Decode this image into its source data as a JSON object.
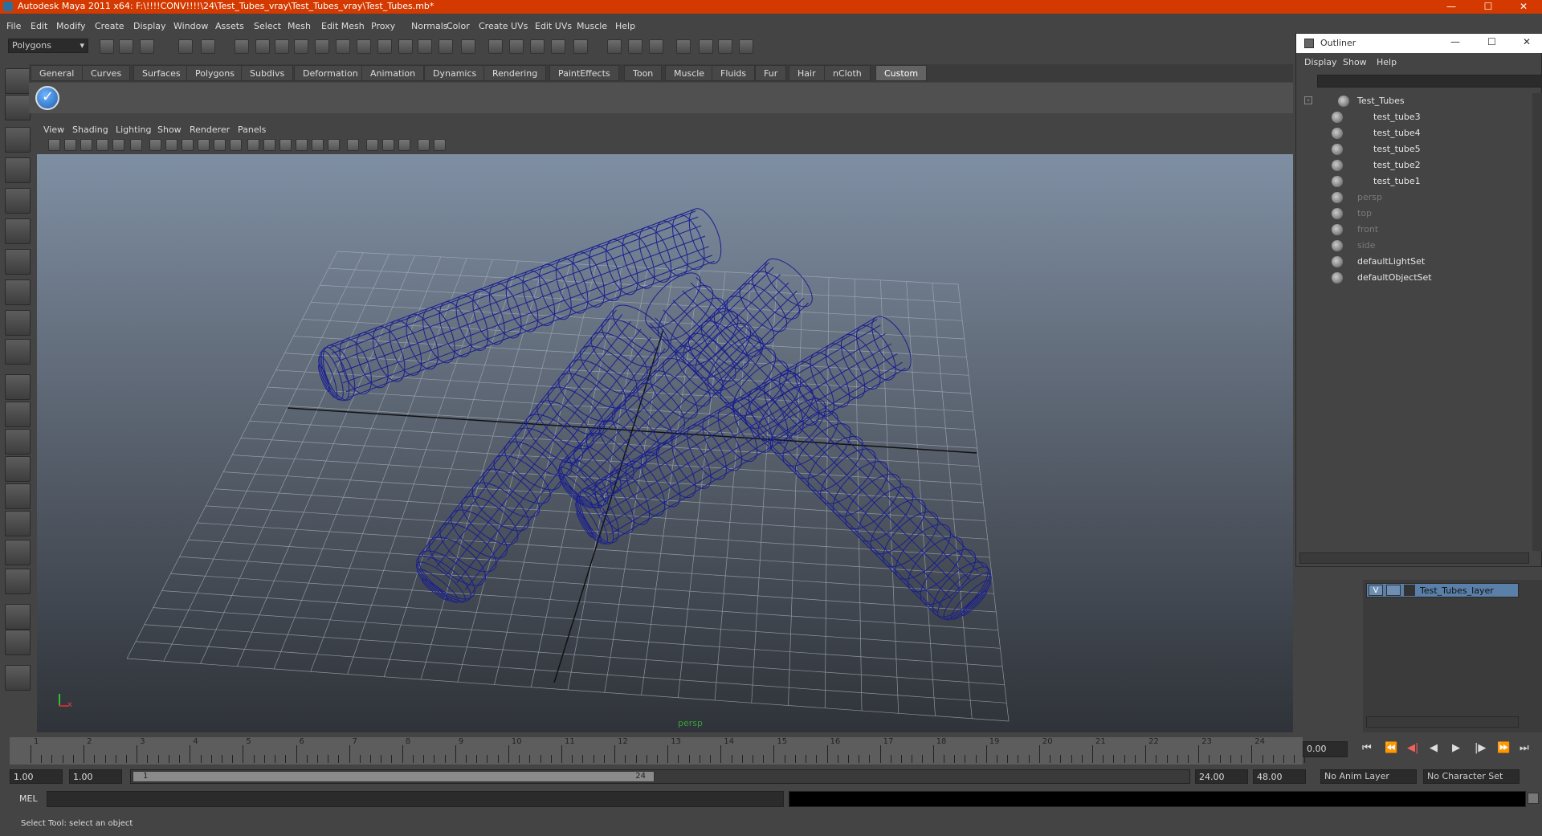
{
  "window_title": "Autodesk Maya 2011 x64: F:\\!!!!CONV!!!!\\24\\Test_Tubes_vray\\Test_Tubes_vray\\Test_Tubes.mb*",
  "menus": [
    "File",
    "Edit",
    "Modify",
    "Create",
    "Display",
    "Window",
    "Assets",
    "Select",
    "Mesh",
    "Edit Mesh",
    "Proxy",
    "Normals",
    "Color",
    "Create UVs",
    "Edit UVs",
    "Muscle",
    "Help"
  ],
  "mode_selector": "Polygons",
  "shelf_tabs": [
    "General",
    "Curves",
    "Surfaces",
    "Polygons",
    "Subdivs",
    "Deformation",
    "Animation",
    "Dynamics",
    "Rendering",
    "PaintEffects",
    "Toon",
    "Muscle",
    "Fluids",
    "Fur",
    "Hair",
    "nCloth",
    "Custom"
  ],
  "active_shelf_tab": "Custom",
  "viewport_menus": [
    "View",
    "Shading",
    "Lighting",
    "Show",
    "Renderer",
    "Panels"
  ],
  "camera_label": "persp",
  "axis_x": "x",
  "timeline": {
    "ticks": [
      "1",
      "2",
      "3",
      "4",
      "5",
      "6",
      "7",
      "8",
      "9",
      "10",
      "11",
      "12",
      "13",
      "14",
      "15",
      "16",
      "17",
      "18",
      "19",
      "20",
      "21",
      "22",
      "23",
      "24"
    ],
    "current_time": "0.00"
  },
  "range": {
    "start_time": "1.00",
    "start_range": "1.00",
    "range_slider_start": "1",
    "range_slider_end": "24",
    "end_range": "24.00",
    "end_time": "48.00",
    "anim_layer": "No Anim Layer",
    "character_set": "No Character Set"
  },
  "mel_label": "MEL",
  "help_line": "Select Tool: select an object",
  "outliner": {
    "title": "Outliner",
    "menus": [
      "Display",
      "Show",
      "Help"
    ],
    "items": [
      {
        "label": "Test_Tubes",
        "level": 0,
        "dim": false
      },
      {
        "label": "test_tube3",
        "level": 1,
        "dim": false
      },
      {
        "label": "test_tube4",
        "level": 1,
        "dim": false
      },
      {
        "label": "test_tube5",
        "level": 1,
        "dim": false
      },
      {
        "label": "test_tube2",
        "level": 1,
        "dim": false
      },
      {
        "label": "test_tube1",
        "level": 1,
        "dim": false
      },
      {
        "label": "persp",
        "level": 0,
        "dim": true
      },
      {
        "label": "top",
        "level": 0,
        "dim": true
      },
      {
        "label": "front",
        "level": 0,
        "dim": true
      },
      {
        "label": "side",
        "level": 0,
        "dim": true
      },
      {
        "label": "defaultLightSet",
        "level": 0,
        "dim": false
      },
      {
        "label": "defaultObjectSet",
        "level": 0,
        "dim": false
      }
    ]
  },
  "layer": {
    "visibility": "V",
    "name": "Test_Tubes_layer"
  }
}
